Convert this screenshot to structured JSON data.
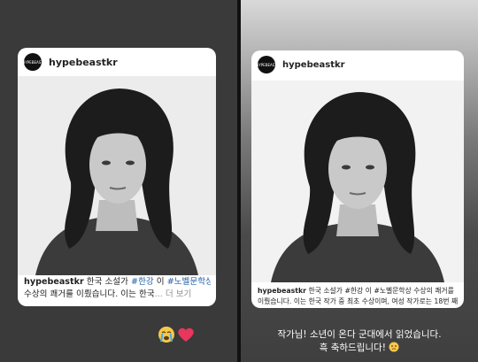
{
  "left_post": {
    "account": "hypebeastkr",
    "avatar_text": "HYPEBEAST",
    "caption_user": "hypebeastkr",
    "caption_text1": "한국 소설가",
    "caption_tag1": "#한강",
    "caption_text2": "이",
    "caption_tag2": "#노벨문학상",
    "caption_line2": "수상의 쾌거를 이뤘습니다. 이는 한국",
    "caption_more": "... 더 보기"
  },
  "right_post": {
    "account": "hypebeastkr",
    "avatar_text": "HYPEBEAST",
    "caption_user": "hypebeastkr",
    "caption_line1": "한국 소설가 #한강 이 #노벨문학상 수상의 쾌거를",
    "caption_line2": "이뤘습니다. 이는 한국 작가 중 최초 수상이며, 여성 작가로는 18번 째..."
  },
  "reaction": {
    "emojis": [
      "loudly-crying-face-icon",
      "heart-icon"
    ]
  },
  "reply": {
    "line1": "작가님! 소년이 온다 군대에서 읽었습니다.",
    "line2": "흑 축하드립니다!"
  },
  "colors": {
    "left_bg": "#3a3a3a",
    "tag_blue": "#1f5fa8",
    "heart": "#e8365d"
  }
}
